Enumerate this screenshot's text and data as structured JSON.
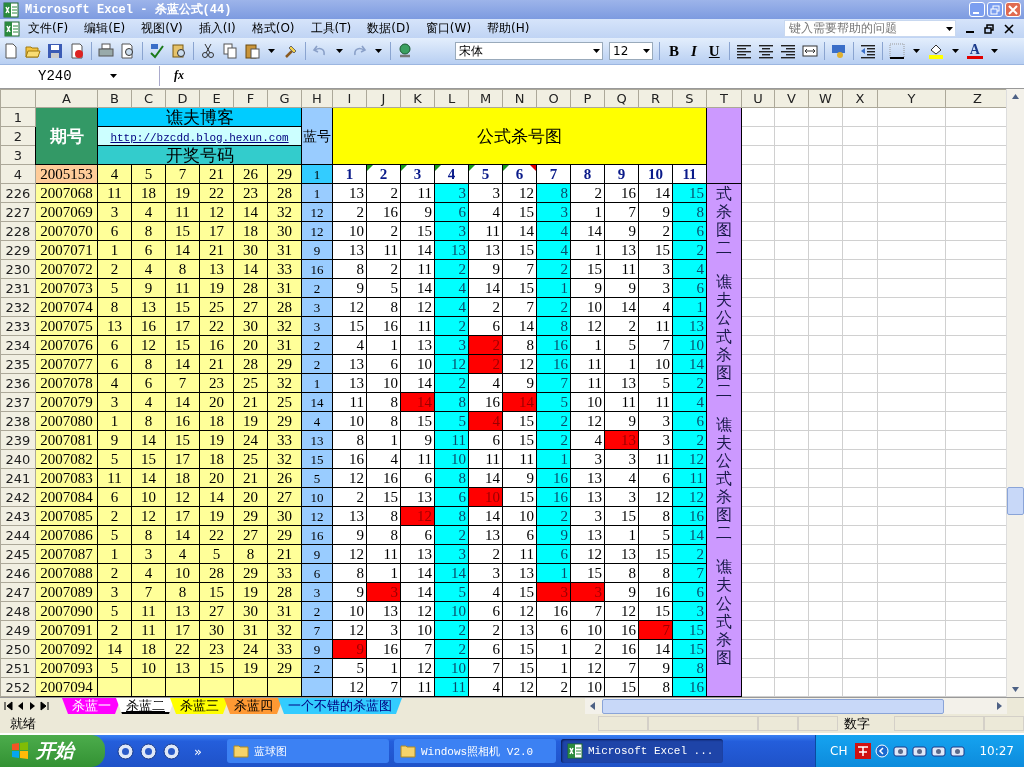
{
  "window": {
    "title": "Microsoft Excel - 杀蓝公式(44)"
  },
  "menu": [
    "文件(F)",
    "编辑(E)",
    "视图(V)",
    "插入(I)",
    "格式(O)",
    "工具(T)",
    "数据(D)",
    "窗口(W)",
    "帮助(H)"
  ],
  "help_box": {
    "placeholder": "键入需要帮助的问题"
  },
  "toolbar": {
    "font": "宋体",
    "size": "12",
    "format_buttons": [
      "B",
      "I",
      "U"
    ],
    "font_color_glyph": "A"
  },
  "formula_bar": {
    "name_box": "Y240",
    "fx": "fx"
  },
  "sheet": {
    "column_headers": [
      "A",
      "B",
      "C",
      "D",
      "E",
      "F",
      "G",
      "H",
      "I",
      "J",
      "K",
      "L",
      "M",
      "N",
      "O",
      "P",
      "Q",
      "R",
      "S",
      "T",
      "U",
      "V",
      "W",
      "X",
      "Y",
      "Z"
    ],
    "top_row_numbers": [
      "1",
      "2",
      "3",
      "4"
    ],
    "header": {
      "period_label": "期号",
      "blog_title": "谯夫博客",
      "blog_link": "http://bzcdd.blog.hexun.com",
      "draw_label": "开奖号码",
      "blue_label": "蓝号",
      "chart_title": "公式杀号图"
    },
    "row_4": {
      "period": "2005153",
      "draw": [
        "4",
        "5",
        "7",
        "21",
        "26",
        "29"
      ],
      "blue": "1",
      "kill_headers": [
        {
          "label": "1",
          "error_mark": false,
          "comment_mark": false
        },
        {
          "label": "2",
          "error_mark": true,
          "comment_mark": false
        },
        {
          "label": "3",
          "error_mark": true,
          "comment_mark": false
        },
        {
          "label": "4",
          "error_mark": true,
          "comment_mark": false
        },
        {
          "label": "5",
          "error_mark": true,
          "comment_mark": false
        },
        {
          "label": "6",
          "error_mark": true,
          "comment_mark": true
        },
        {
          "label": "7",
          "error_mark": false,
          "comment_mark": false
        },
        {
          "label": "8",
          "error_mark": false,
          "comment_mark": false
        },
        {
          "label": "9",
          "error_mark": false,
          "comment_mark": false
        },
        {
          "label": "10",
          "error_mark": false,
          "comment_mark": false
        },
        {
          "label": "11",
          "error_mark": false,
          "comment_mark": false
        }
      ]
    },
    "side_text": [
      "式杀图二",
      "谯夫公式杀图二",
      "谯夫公式杀图二",
      "谯夫公式杀图"
    ],
    "rows": [
      {
        "number": "226",
        "period": "2007068",
        "draw": [
          "11",
          "18",
          "19",
          "22",
          "23",
          "28"
        ],
        "blue": "1",
        "kills": [
          {
            "value": "13",
            "color": "#ffffff"
          },
          {
            "value": "2",
            "color": "#ffffff"
          },
          {
            "value": "11",
            "color": "#ffffff"
          },
          {
            "value": "3",
            "color": "#00ffff"
          },
          {
            "value": "3",
            "color": "#ffffff"
          },
          {
            "value": "12",
            "color": "#ffffff"
          },
          {
            "value": "8",
            "color": "#00ffff"
          },
          {
            "value": "2",
            "color": "#ffffff"
          },
          {
            "value": "16",
            "color": "#ffffff"
          },
          {
            "value": "14",
            "color": "#ffffff"
          },
          {
            "value": "15",
            "color": "#00ffff"
          }
        ]
      },
      {
        "number": "227",
        "period": "2007069",
        "draw": [
          "3",
          "4",
          "11",
          "12",
          "14",
          "32"
        ],
        "blue": "12",
        "kills": [
          {
            "value": "2",
            "color": "#ffffff"
          },
          {
            "value": "16",
            "color": "#ffffff"
          },
          {
            "value": "9",
            "color": "#ffffff"
          },
          {
            "value": "6",
            "color": "#00ffff"
          },
          {
            "value": "4",
            "color": "#ffffff"
          },
          {
            "value": "15",
            "color": "#ffffff"
          },
          {
            "value": "3",
            "color": "#00ffff"
          },
          {
            "value": "1",
            "color": "#ffffff"
          },
          {
            "value": "7",
            "color": "#ffffff"
          },
          {
            "value": "9",
            "color": "#ffffff"
          },
          {
            "value": "8",
            "color": "#00ffff"
          }
        ]
      },
      {
        "number": "228",
        "period": "2007070",
        "draw": [
          "6",
          "8",
          "15",
          "17",
          "18",
          "30"
        ],
        "blue": "12",
        "kills": [
          {
            "value": "10",
            "color": "#ffffff"
          },
          {
            "value": "2",
            "color": "#ffffff"
          },
          {
            "value": "15",
            "color": "#ffffff"
          },
          {
            "value": "3",
            "color": "#00ffff"
          },
          {
            "value": "11",
            "color": "#ffffff"
          },
          {
            "value": "14",
            "color": "#ffffff"
          },
          {
            "value": "4",
            "color": "#00ffff"
          },
          {
            "value": "14",
            "color": "#ffffff"
          },
          {
            "value": "9",
            "color": "#ffffff"
          },
          {
            "value": "2",
            "color": "#ffffff"
          },
          {
            "value": "6",
            "color": "#00ffff"
          }
        ]
      },
      {
        "number": "229",
        "period": "2007071",
        "draw": [
          "1",
          "6",
          "14",
          "21",
          "30",
          "31"
        ],
        "blue": "9",
        "kills": [
          {
            "value": "13",
            "color": "#ffffff"
          },
          {
            "value": "11",
            "color": "#ffffff"
          },
          {
            "value": "14",
            "color": "#ffffff"
          },
          {
            "value": "13",
            "color": "#00ffff"
          },
          {
            "value": "13",
            "color": "#ffffff"
          },
          {
            "value": "15",
            "color": "#ffffff"
          },
          {
            "value": "4",
            "color": "#00ffff"
          },
          {
            "value": "1",
            "color": "#ffffff"
          },
          {
            "value": "13",
            "color": "#ffffff"
          },
          {
            "value": "15",
            "color": "#ffffff"
          },
          {
            "value": "2",
            "color": "#00ffff"
          }
        ]
      },
      {
        "number": "230",
        "period": "2007072",
        "draw": [
          "2",
          "4",
          "8",
          "13",
          "14",
          "33"
        ],
        "blue": "16",
        "kills": [
          {
            "value": "8",
            "color": "#ffffff"
          },
          {
            "value": "2",
            "color": "#ffffff"
          },
          {
            "value": "11",
            "color": "#ffffff"
          },
          {
            "value": "2",
            "color": "#00ffff"
          },
          {
            "value": "9",
            "color": "#ffffff"
          },
          {
            "value": "7",
            "color": "#ffffff"
          },
          {
            "value": "2",
            "color": "#00ffff"
          },
          {
            "value": "15",
            "color": "#ffffff"
          },
          {
            "value": "11",
            "color": "#ffffff"
          },
          {
            "value": "3",
            "color": "#ffffff"
          },
          {
            "value": "4",
            "color": "#00ffff"
          }
        ]
      },
      {
        "number": "231",
        "period": "2007073",
        "draw": [
          "5",
          "9",
          "11",
          "19",
          "28",
          "31"
        ],
        "blue": "2",
        "kills": [
          {
            "value": "9",
            "color": "#ffffff"
          },
          {
            "value": "5",
            "color": "#ffffff"
          },
          {
            "value": "14",
            "color": "#ffffff"
          },
          {
            "value": "4",
            "color": "#00ffff"
          },
          {
            "value": "14",
            "color": "#ffffff"
          },
          {
            "value": "15",
            "color": "#ffffff"
          },
          {
            "value": "1",
            "color": "#00ffff"
          },
          {
            "value": "9",
            "color": "#ffffff"
          },
          {
            "value": "9",
            "color": "#ffffff"
          },
          {
            "value": "3",
            "color": "#ffffff"
          },
          {
            "value": "6",
            "color": "#00ffff"
          }
        ]
      },
      {
        "number": "232",
        "period": "2007074",
        "draw": [
          "8",
          "13",
          "15",
          "25",
          "27",
          "28"
        ],
        "blue": "3",
        "kills": [
          {
            "value": "12",
            "color": "#ffffff"
          },
          {
            "value": "8",
            "color": "#ffffff"
          },
          {
            "value": "12",
            "color": "#ffffff"
          },
          {
            "value": "4",
            "color": "#00ffff"
          },
          {
            "value": "2",
            "color": "#ffffff"
          },
          {
            "value": "7",
            "color": "#ffffff"
          },
          {
            "value": "2",
            "color": "#00ffff"
          },
          {
            "value": "10",
            "color": "#ffffff"
          },
          {
            "value": "14",
            "color": "#ffffff"
          },
          {
            "value": "4",
            "color": "#ffffff"
          },
          {
            "value": "1",
            "color": "#00ffff"
          }
        ]
      },
      {
        "number": "233",
        "period": "2007075",
        "draw": [
          "13",
          "16",
          "17",
          "22",
          "30",
          "32"
        ],
        "blue": "3",
        "kills": [
          {
            "value": "15",
            "color": "#ffffff"
          },
          {
            "value": "16",
            "color": "#ffffff"
          },
          {
            "value": "11",
            "color": "#ffffff"
          },
          {
            "value": "2",
            "color": "#00ffff"
          },
          {
            "value": "6",
            "color": "#ffffff"
          },
          {
            "value": "14",
            "color": "#ffffff"
          },
          {
            "value": "8",
            "color": "#00ffff"
          },
          {
            "value": "12",
            "color": "#ffffff"
          },
          {
            "value": "2",
            "color": "#ffffff"
          },
          {
            "value": "11",
            "color": "#ffffff"
          },
          {
            "value": "13",
            "color": "#00ffff"
          }
        ]
      },
      {
        "number": "234",
        "period": "2007076",
        "draw": [
          "6",
          "12",
          "15",
          "16",
          "20",
          "31"
        ],
        "blue": "2",
        "kills": [
          {
            "value": "4",
            "color": "#ffffff"
          },
          {
            "value": "1",
            "color": "#ffffff"
          },
          {
            "value": "13",
            "color": "#ffffff"
          },
          {
            "value": "3",
            "color": "#00ffff"
          },
          {
            "value": "2",
            "color": "#ff0000"
          },
          {
            "value": "8",
            "color": "#ffffff"
          },
          {
            "value": "16",
            "color": "#00ffff"
          },
          {
            "value": "1",
            "color": "#ffffff"
          },
          {
            "value": "5",
            "color": "#ffffff"
          },
          {
            "value": "7",
            "color": "#ffffff"
          },
          {
            "value": "10",
            "color": "#00ffff"
          }
        ]
      },
      {
        "number": "235",
        "period": "2007077",
        "draw": [
          "6",
          "8",
          "14",
          "21",
          "28",
          "29"
        ],
        "blue": "2",
        "kills": [
          {
            "value": "13",
            "color": "#ffffff"
          },
          {
            "value": "6",
            "color": "#ffffff"
          },
          {
            "value": "10",
            "color": "#ffffff"
          },
          {
            "value": "12",
            "color": "#00ffff"
          },
          {
            "value": "2",
            "color": "#ff0000"
          },
          {
            "value": "12",
            "color": "#ffffff"
          },
          {
            "value": "16",
            "color": "#00ffff"
          },
          {
            "value": "11",
            "color": "#ffffff"
          },
          {
            "value": "1",
            "color": "#ffffff"
          },
          {
            "value": "10",
            "color": "#ffffff"
          },
          {
            "value": "14",
            "color": "#00ffff"
          }
        ]
      },
      {
        "number": "236",
        "period": "2007078",
        "draw": [
          "4",
          "6",
          "7",
          "23",
          "25",
          "32"
        ],
        "blue": "1",
        "kills": [
          {
            "value": "13",
            "color": "#ffffff"
          },
          {
            "value": "10",
            "color": "#ffffff"
          },
          {
            "value": "14",
            "color": "#ffffff"
          },
          {
            "value": "2",
            "color": "#00ffff"
          },
          {
            "value": "4",
            "color": "#ffffff"
          },
          {
            "value": "9",
            "color": "#ffffff"
          },
          {
            "value": "7",
            "color": "#00ffff"
          },
          {
            "value": "11",
            "color": "#ffffff"
          },
          {
            "value": "13",
            "color": "#ffffff"
          },
          {
            "value": "5",
            "color": "#ffffff"
          },
          {
            "value": "2",
            "color": "#00ffff"
          }
        ]
      },
      {
        "number": "237",
        "period": "2007079",
        "draw": [
          "3",
          "4",
          "14",
          "20",
          "21",
          "25"
        ],
        "blue": "14",
        "kills": [
          {
            "value": "11",
            "color": "#ffffff"
          },
          {
            "value": "8",
            "color": "#ffffff"
          },
          {
            "value": "14",
            "color": "#ff0000"
          },
          {
            "value": "8",
            "color": "#00ffff"
          },
          {
            "value": "16",
            "color": "#ffffff"
          },
          {
            "value": "14",
            "color": "#ff0000"
          },
          {
            "value": "5",
            "color": "#00ffff"
          },
          {
            "value": "10",
            "color": "#ffffff"
          },
          {
            "value": "11",
            "color": "#ffffff"
          },
          {
            "value": "11",
            "color": "#ffffff"
          },
          {
            "value": "4",
            "color": "#00ffff"
          }
        ]
      },
      {
        "number": "238",
        "period": "2007080",
        "draw": [
          "1",
          "8",
          "16",
          "18",
          "19",
          "29"
        ],
        "blue": "4",
        "kills": [
          {
            "value": "10",
            "color": "#ffffff"
          },
          {
            "value": "8",
            "color": "#ffffff"
          },
          {
            "value": "15",
            "color": "#ffffff"
          },
          {
            "value": "5",
            "color": "#00ffff"
          },
          {
            "value": "4",
            "color": "#ff0000"
          },
          {
            "value": "15",
            "color": "#ffffff"
          },
          {
            "value": "2",
            "color": "#00ffff"
          },
          {
            "value": "12",
            "color": "#ffffff"
          },
          {
            "value": "9",
            "color": "#ffffff"
          },
          {
            "value": "3",
            "color": "#ffffff"
          },
          {
            "value": "6",
            "color": "#00ffff"
          }
        ]
      },
      {
        "number": "239",
        "period": "2007081",
        "draw": [
          "9",
          "14",
          "15",
          "19",
          "24",
          "33"
        ],
        "blue": "13",
        "kills": [
          {
            "value": "8",
            "color": "#ffffff"
          },
          {
            "value": "1",
            "color": "#ffffff"
          },
          {
            "value": "9",
            "color": "#ffffff"
          },
          {
            "value": "11",
            "color": "#00ffff"
          },
          {
            "value": "6",
            "color": "#ffffff"
          },
          {
            "value": "15",
            "color": "#ffffff"
          },
          {
            "value": "2",
            "color": "#00ffff"
          },
          {
            "value": "4",
            "color": "#ffffff"
          },
          {
            "value": "13",
            "color": "#ff0000"
          },
          {
            "value": "3",
            "color": "#ffffff"
          },
          {
            "value": "2",
            "color": "#00ffff"
          }
        ]
      },
      {
        "number": "240",
        "period": "2007082",
        "draw": [
          "5",
          "15",
          "17",
          "18",
          "25",
          "32"
        ],
        "blue": "15",
        "kills": [
          {
            "value": "16",
            "color": "#ffffff"
          },
          {
            "value": "4",
            "color": "#ffffff"
          },
          {
            "value": "11",
            "color": "#ffffff"
          },
          {
            "value": "10",
            "color": "#00ffff"
          },
          {
            "value": "11",
            "color": "#ffffff"
          },
          {
            "value": "11",
            "color": "#ffffff"
          },
          {
            "value": "1",
            "color": "#00ffff"
          },
          {
            "value": "3",
            "color": "#ffffff"
          },
          {
            "value": "3",
            "color": "#ffffff"
          },
          {
            "value": "11",
            "color": "#ffffff"
          },
          {
            "value": "12",
            "color": "#00ffff"
          }
        ]
      },
      {
        "number": "241",
        "period": "2007083",
        "draw": [
          "11",
          "14",
          "18",
          "20",
          "21",
          "26"
        ],
        "blue": "5",
        "kills": [
          {
            "value": "12",
            "color": "#ffffff"
          },
          {
            "value": "16",
            "color": "#ffffff"
          },
          {
            "value": "6",
            "color": "#ffffff"
          },
          {
            "value": "8",
            "color": "#00ffff"
          },
          {
            "value": "14",
            "color": "#ffffff"
          },
          {
            "value": "9",
            "color": "#ffffff"
          },
          {
            "value": "16",
            "color": "#00ffff"
          },
          {
            "value": "13",
            "color": "#ffffff"
          },
          {
            "value": "4",
            "color": "#ffffff"
          },
          {
            "value": "6",
            "color": "#ffffff"
          },
          {
            "value": "11",
            "color": "#00ffff"
          }
        ]
      },
      {
        "number": "242",
        "period": "2007084",
        "draw": [
          "6",
          "10",
          "12",
          "14",
          "20",
          "27"
        ],
        "blue": "10",
        "kills": [
          {
            "value": "2",
            "color": "#ffffff"
          },
          {
            "value": "15",
            "color": "#ffffff"
          },
          {
            "value": "13",
            "color": "#ffffff"
          },
          {
            "value": "6",
            "color": "#00ffff"
          },
          {
            "value": "10",
            "color": "#ff0000"
          },
          {
            "value": "15",
            "color": "#ffffff"
          },
          {
            "value": "16",
            "color": "#00ffff"
          },
          {
            "value": "13",
            "color": "#ffffff"
          },
          {
            "value": "3",
            "color": "#ffffff"
          },
          {
            "value": "12",
            "color": "#ffffff"
          },
          {
            "value": "12",
            "color": "#00ffff"
          }
        ]
      },
      {
        "number": "243",
        "period": "2007085",
        "draw": [
          "2",
          "12",
          "17",
          "19",
          "29",
          "30"
        ],
        "blue": "12",
        "kills": [
          {
            "value": "13",
            "color": "#ffffff"
          },
          {
            "value": "8",
            "color": "#ffffff"
          },
          {
            "value": "12",
            "color": "#ff0000"
          },
          {
            "value": "8",
            "color": "#00ffff"
          },
          {
            "value": "14",
            "color": "#ffffff"
          },
          {
            "value": "10",
            "color": "#ffffff"
          },
          {
            "value": "2",
            "color": "#00ffff"
          },
          {
            "value": "3",
            "color": "#ffffff"
          },
          {
            "value": "15",
            "color": "#ffffff"
          },
          {
            "value": "8",
            "color": "#ffffff"
          },
          {
            "value": "16",
            "color": "#00ffff"
          }
        ]
      },
      {
        "number": "244",
        "period": "2007086",
        "draw": [
          "5",
          "8",
          "14",
          "22",
          "27",
          "29"
        ],
        "blue": "16",
        "kills": [
          {
            "value": "9",
            "color": "#ffffff"
          },
          {
            "value": "8",
            "color": "#ffffff"
          },
          {
            "value": "6",
            "color": "#ffffff"
          },
          {
            "value": "2",
            "color": "#00ffff"
          },
          {
            "value": "13",
            "color": "#ffffff"
          },
          {
            "value": "6",
            "color": "#ffffff"
          },
          {
            "value": "9",
            "color": "#00ffff"
          },
          {
            "value": "13",
            "color": "#ffffff"
          },
          {
            "value": "1",
            "color": "#ffffff"
          },
          {
            "value": "5",
            "color": "#ffffff"
          },
          {
            "value": "14",
            "color": "#00ffff"
          }
        ]
      },
      {
        "number": "245",
        "period": "2007087",
        "draw": [
          "1",
          "3",
          "4",
          "5",
          "8",
          "21"
        ],
        "blue": "9",
        "kills": [
          {
            "value": "12",
            "color": "#ffffff"
          },
          {
            "value": "11",
            "color": "#ffffff"
          },
          {
            "value": "13",
            "color": "#ffffff"
          },
          {
            "value": "3",
            "color": "#00ffff"
          },
          {
            "value": "2",
            "color": "#ffffff"
          },
          {
            "value": "11",
            "color": "#ffffff"
          },
          {
            "value": "6",
            "color": "#00ffff"
          },
          {
            "value": "12",
            "color": "#ffffff"
          },
          {
            "value": "13",
            "color": "#ffffff"
          },
          {
            "value": "15",
            "color": "#ffffff"
          },
          {
            "value": "2",
            "color": "#00ffff"
          }
        ]
      },
      {
        "number": "246",
        "period": "2007088",
        "draw": [
          "2",
          "4",
          "10",
          "28",
          "29",
          "33"
        ],
        "blue": "6",
        "kills": [
          {
            "value": "8",
            "color": "#ffffff"
          },
          {
            "value": "1",
            "color": "#ffffff"
          },
          {
            "value": "14",
            "color": "#ffffff"
          },
          {
            "value": "14",
            "color": "#00ffff"
          },
          {
            "value": "3",
            "color": "#ffffff"
          },
          {
            "value": "13",
            "color": "#ffffff"
          },
          {
            "value": "1",
            "color": "#00ffff"
          },
          {
            "value": "15",
            "color": "#ffffff"
          },
          {
            "value": "8",
            "color": "#ffffff"
          },
          {
            "value": "8",
            "color": "#ffffff"
          },
          {
            "value": "7",
            "color": "#00ffff"
          }
        ]
      },
      {
        "number": "247",
        "period": "2007089",
        "draw": [
          "3",
          "7",
          "8",
          "15",
          "19",
          "28"
        ],
        "blue": "3",
        "kills": [
          {
            "value": "9",
            "color": "#ffffff"
          },
          {
            "value": "3",
            "color": "#ff0000"
          },
          {
            "value": "14",
            "color": "#ffffff"
          },
          {
            "value": "5",
            "color": "#00ffff"
          },
          {
            "value": "4",
            "color": "#ffffff"
          },
          {
            "value": "15",
            "color": "#ffffff"
          },
          {
            "value": "3",
            "color": "#ff0000"
          },
          {
            "value": "3",
            "color": "#ff0000"
          },
          {
            "value": "9",
            "color": "#ffffff"
          },
          {
            "value": "16",
            "color": "#ffffff"
          },
          {
            "value": "6",
            "color": "#00ffff"
          }
        ]
      },
      {
        "number": "248",
        "period": "2007090",
        "draw": [
          "5",
          "11",
          "13",
          "27",
          "30",
          "31"
        ],
        "blue": "2",
        "kills": [
          {
            "value": "10",
            "color": "#ffffff"
          },
          {
            "value": "13",
            "color": "#ffffff"
          },
          {
            "value": "12",
            "color": "#ffffff"
          },
          {
            "value": "10",
            "color": "#00ffff"
          },
          {
            "value": "6",
            "color": "#ffffff"
          },
          {
            "value": "12",
            "color": "#ffffff"
          },
          {
            "value": "16",
            "color": "#ffffff"
          },
          {
            "value": "7",
            "color": "#ffffff"
          },
          {
            "value": "12",
            "color": "#ffffff"
          },
          {
            "value": "15",
            "color": "#ffffff"
          },
          {
            "value": "3",
            "color": "#00ffff"
          }
        ]
      },
      {
        "number": "249",
        "period": "2007091",
        "draw": [
          "2",
          "11",
          "17",
          "30",
          "31",
          "32"
        ],
        "blue": "7",
        "kills": [
          {
            "value": "12",
            "color": "#ffffff"
          },
          {
            "value": "3",
            "color": "#ffffff"
          },
          {
            "value": "10",
            "color": "#ffffff"
          },
          {
            "value": "2",
            "color": "#00ffff"
          },
          {
            "value": "2",
            "color": "#ffffff"
          },
          {
            "value": "13",
            "color": "#ffffff"
          },
          {
            "value": "6",
            "color": "#ffffff"
          },
          {
            "value": "10",
            "color": "#ffffff"
          },
          {
            "value": "16",
            "color": "#ffffff"
          },
          {
            "value": "7",
            "color": "#ff0000"
          },
          {
            "value": "15",
            "color": "#00ffff"
          }
        ]
      },
      {
        "number": "250",
        "period": "2007092",
        "draw": [
          "14",
          "18",
          "22",
          "23",
          "24",
          "33"
        ],
        "blue": "9",
        "kills": [
          {
            "value": "9",
            "color": "#ff0000"
          },
          {
            "value": "16",
            "color": "#ffffff"
          },
          {
            "value": "7",
            "color": "#ffffff"
          },
          {
            "value": "2",
            "color": "#00ffff"
          },
          {
            "value": "6",
            "color": "#ffffff"
          },
          {
            "value": "15",
            "color": "#ffffff"
          },
          {
            "value": "1",
            "color": "#ffffff"
          },
          {
            "value": "2",
            "color": "#ffffff"
          },
          {
            "value": "16",
            "color": "#ffffff"
          },
          {
            "value": "14",
            "color": "#ffffff"
          },
          {
            "value": "15",
            "color": "#00ffff"
          }
        ]
      },
      {
        "number": "251",
        "period": "2007093",
        "draw": [
          "5",
          "10",
          "13",
          "15",
          "19",
          "29"
        ],
        "blue": "2",
        "kills": [
          {
            "value": "5",
            "color": "#ffffff"
          },
          {
            "value": "1",
            "color": "#ffffff"
          },
          {
            "value": "12",
            "color": "#ffffff"
          },
          {
            "value": "10",
            "color": "#00ffff"
          },
          {
            "value": "7",
            "color": "#ffffff"
          },
          {
            "value": "15",
            "color": "#ffffff"
          },
          {
            "value": "1",
            "color": "#ffffff"
          },
          {
            "value": "12",
            "color": "#ffffff"
          },
          {
            "value": "7",
            "color": "#ffffff"
          },
          {
            "value": "9",
            "color": "#ffffff"
          },
          {
            "value": "8",
            "color": "#00ffff"
          }
        ]
      },
      {
        "number": "252",
        "period": "2007094",
        "kills": [
          {
            "value": "12",
            "color": "#ffffff"
          },
          {
            "value": "7",
            "color": "#ffffff"
          },
          {
            "value": "11",
            "color": "#ffffff"
          },
          {
            "value": "11",
            "color": "#00ffff"
          },
          {
            "value": "4",
            "color": "#ffffff"
          },
          {
            "value": "12",
            "color": "#ffffff"
          },
          {
            "value": "2",
            "color": "#ffffff"
          },
          {
            "value": "10",
            "color": "#ffffff"
          },
          {
            "value": "15",
            "color": "#ffffff"
          },
          {
            "value": "8",
            "color": "#ffffff"
          },
          {
            "value": "16",
            "color": "#00ffff"
          }
        ]
      }
    ]
  },
  "sheet_tabs": [
    {
      "label": "杀蓝一",
      "color": "#ff00ff",
      "selected": false
    },
    {
      "label": "杀蓝二",
      "color": "#ffffff",
      "selected": true
    },
    {
      "label": "杀蓝三",
      "color": "#ffff00",
      "selected": false
    },
    {
      "label": "杀蓝四",
      "color": "#ff9933",
      "selected": false
    },
    {
      "label": "一个不错的杀蓝图",
      "color": "#33ccff",
      "selected": false
    }
  ],
  "status_bar": {
    "left": "就绪",
    "mode": "数字"
  },
  "taskbar": {
    "start": "开始",
    "more": "»",
    "tasks": [
      {
        "label": "蓝球图",
        "kind": "folder",
        "selected": false
      },
      {
        "label": "Windows照相机 V2.0",
        "kind": "folder",
        "selected": false
      },
      {
        "label": "Microsoft Excel ...",
        "kind": "excel",
        "selected": true
      }
    ],
    "language": "CH",
    "clock": "10:27"
  }
}
